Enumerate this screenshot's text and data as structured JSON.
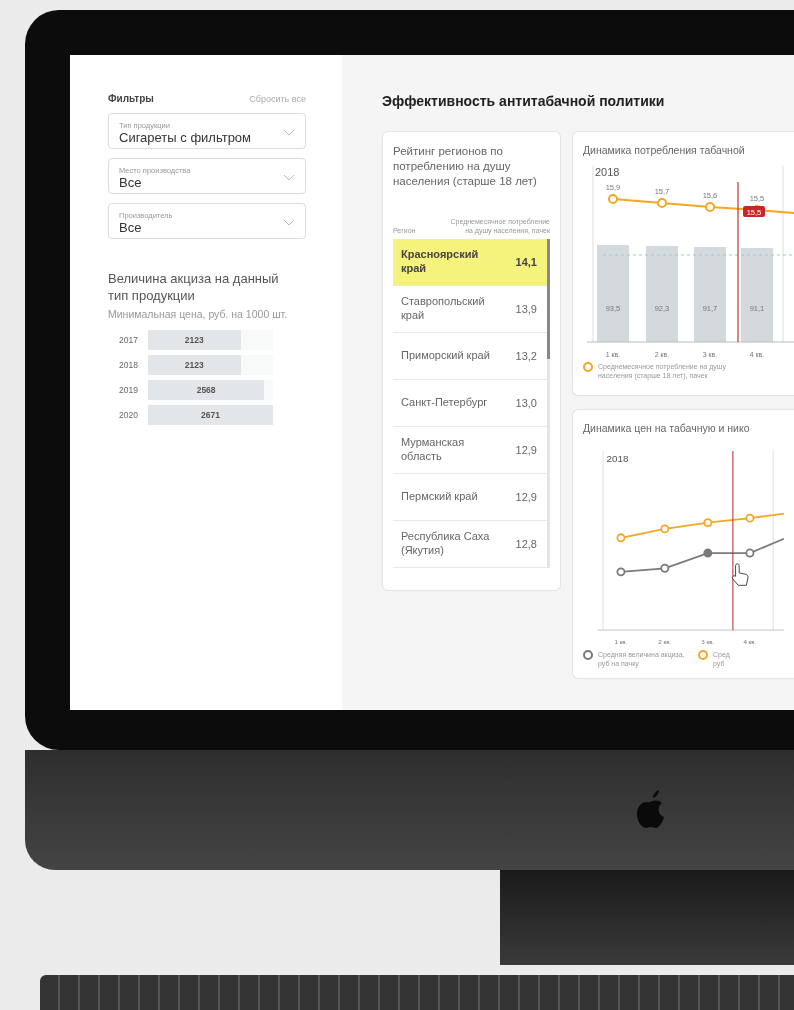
{
  "sidebar": {
    "title": "Фильтры",
    "reset": "Сбросить все",
    "filters": [
      {
        "label": "Тип продукции",
        "value": "Сигареты с фильтром"
      },
      {
        "label": "Место производства",
        "value": "Все"
      },
      {
        "label": "Производитель",
        "value": "Все"
      }
    ],
    "excise": {
      "title": "Величина акциза на данный тип продукции",
      "subtitle": "Минимальная цена, руб. на 1000 шт.",
      "bars": [
        {
          "year": "2017",
          "value": "2123",
          "level": 0.74
        },
        {
          "year": "2018",
          "value": "2123",
          "level": 0.74
        },
        {
          "year": "2019",
          "value": "2568",
          "level": 0.93
        },
        {
          "year": "2020",
          "value": "2671",
          "level": 1
        }
      ]
    }
  },
  "main": {
    "title": "Эффективность антитабачной политики",
    "ranking": {
      "title": "Рейтинг регионов по потреблению на душу населения (старше 18 лет)",
      "columns": [
        "Регион",
        "Среднемесячное потребление на душу населения, пачек"
      ],
      "rows": [
        {
          "region": "Красноярский край",
          "value": "14,1",
          "selected": true
        },
        {
          "region": "Ставропольский край",
          "value": "13,9",
          "selected": false
        },
        {
          "region": "Приморский край",
          "value": "13,2",
          "selected": false
        },
        {
          "region": "Санкт-Петербург",
          "value": "13,0",
          "selected": false
        },
        {
          "region": "Мурманская область",
          "value": "12,9",
          "selected": false
        },
        {
          "region": "Пермский край",
          "value": "12,9",
          "selected": false
        },
        {
          "region": "Республика Саха (Якутия)",
          "value": "12,8",
          "selected": false
        }
      ]
    },
    "consumption": {
      "title": "Динамика потребления табачной",
      "year": "2018",
      "marker_label": "15,5",
      "x_labels": [
        "1 кв.",
        "2 кв.",
        "3 кв.",
        "4 кв."
      ],
      "bar_labels": [
        "93,5",
        "92,3",
        "91,7",
        "91,1"
      ],
      "point_labels": [
        "15,9",
        "15,7",
        "15,6",
        "15,5"
      ],
      "legend": [
        {
          "label": "Среднемесячное потребление на душу населения (старше 18 лет), пачек",
          "color": "#f5a623"
        }
      ]
    },
    "prices": {
      "title": "Динамика цен на табачную и нико",
      "year": "2018",
      "x_labels": [
        "1 кв.",
        "2 кв.",
        "3 кв.",
        "4 кв."
      ],
      "legend": [
        {
          "label": "Средняя величина акциза, руб на пачку",
          "color": "#7a7a7a"
        },
        {
          "label": "Сред руб",
          "color": "#f5a623"
        }
      ]
    }
  }
}
